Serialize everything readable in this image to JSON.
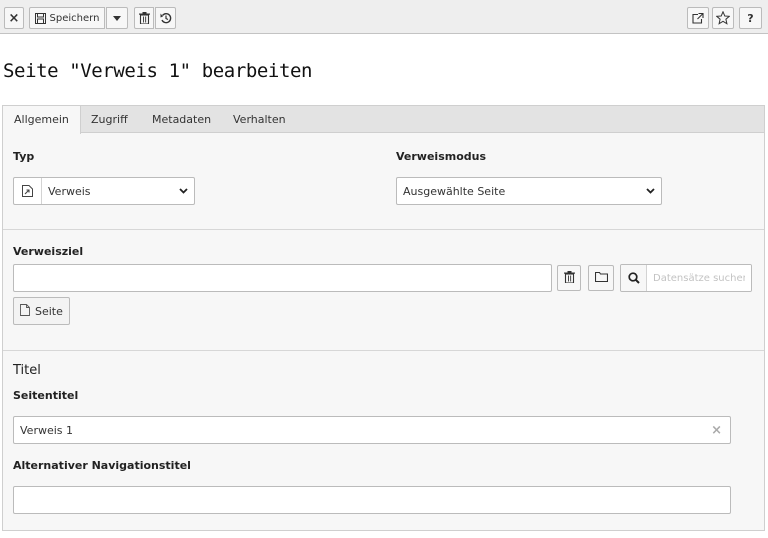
{
  "toolbar": {
    "close_label": "×",
    "save_label": "Speichern",
    "help_label": "?"
  },
  "page_title": "Seite \"Verweis 1\" bearbeiten",
  "tabs": [
    {
      "label": "Allgemein",
      "active": true
    },
    {
      "label": "Zugriff",
      "active": false
    },
    {
      "label": "Metadaten",
      "active": false
    },
    {
      "label": "Verhalten",
      "active": false
    }
  ],
  "typ": {
    "label": "Typ",
    "selected": "Verweis"
  },
  "verweismodus": {
    "label": "Verweismodus",
    "selected": "Ausgewählte Seite"
  },
  "verweisziel": {
    "label": "Verweisziel",
    "value": "",
    "search_placeholder": "Datensätze suchen",
    "page_button_label": "Seite"
  },
  "titel_section": {
    "heading": "Titel",
    "seitentitel_label": "Seitentitel",
    "seitentitel_value": "Verweis 1",
    "clear_label": "×",
    "nav_title_label": "Alternativer Navigationstitel",
    "nav_title_value": ""
  }
}
